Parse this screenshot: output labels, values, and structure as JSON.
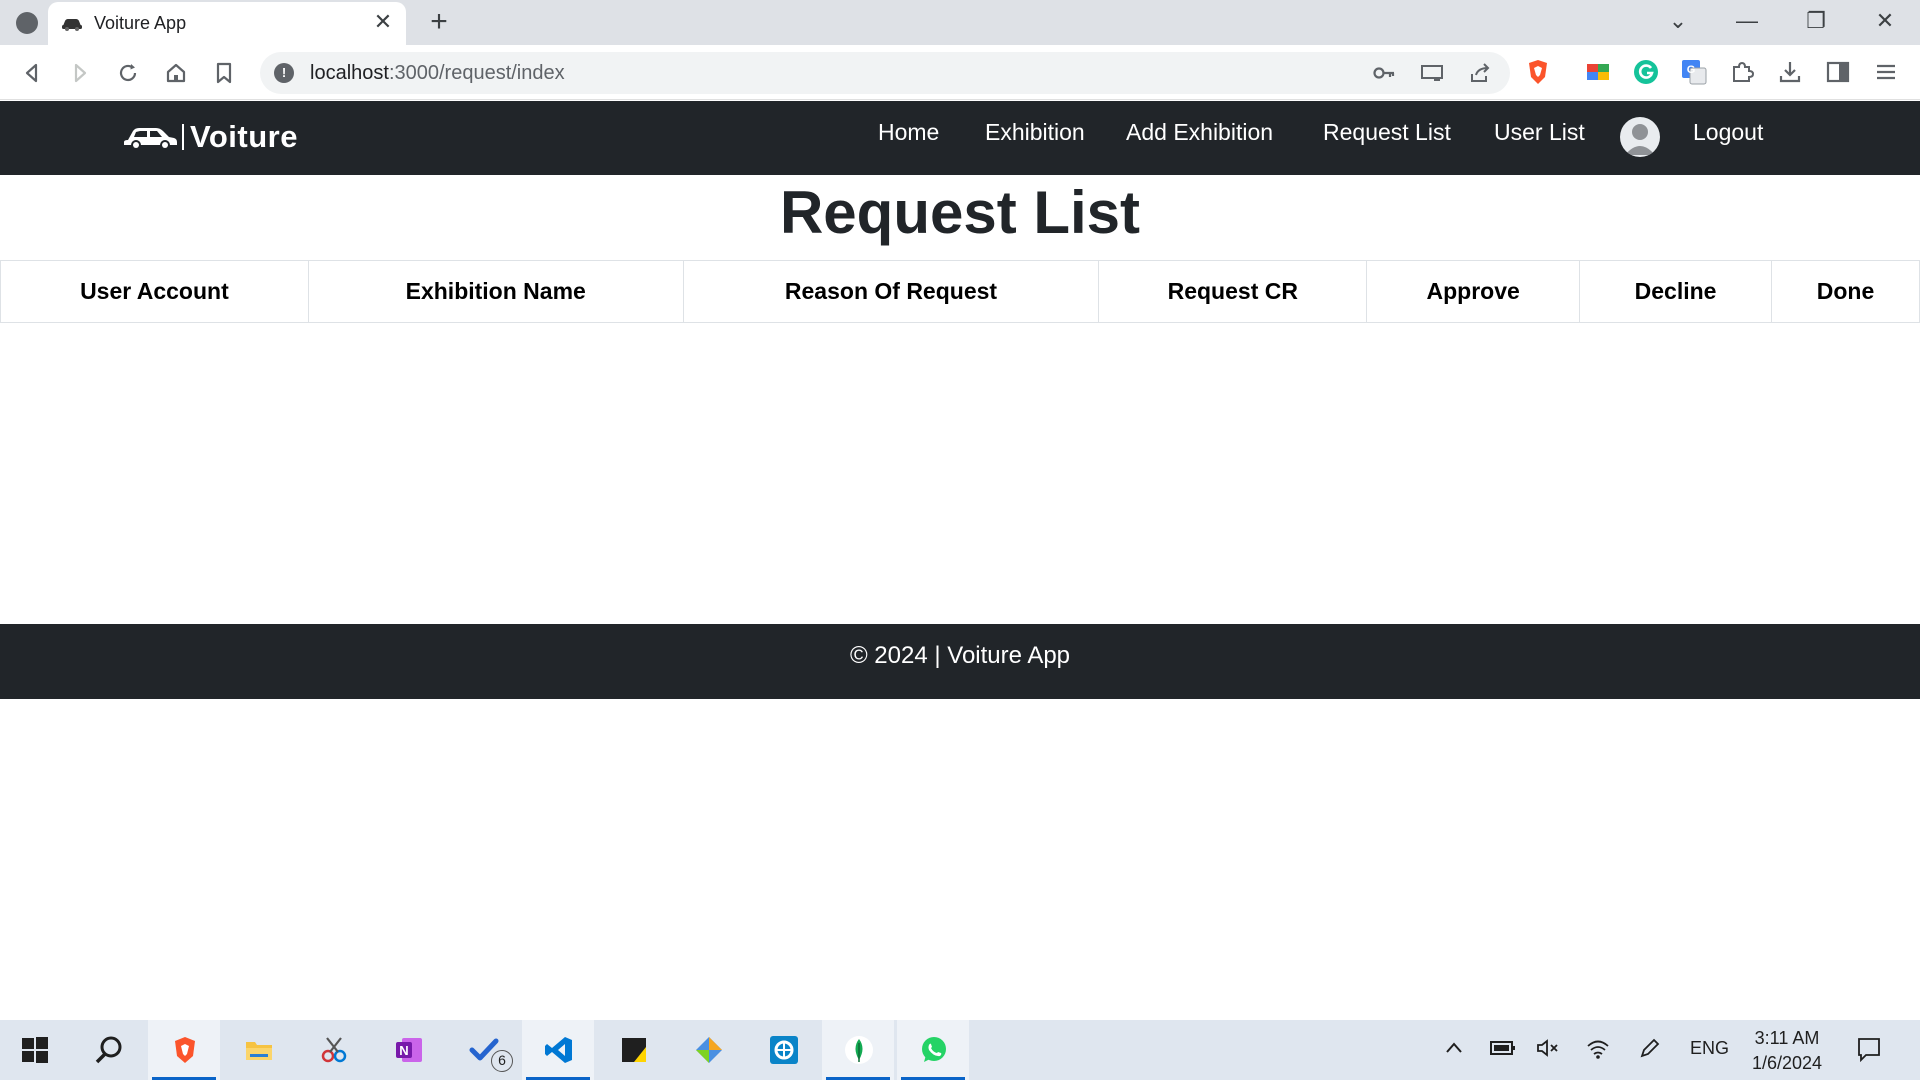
{
  "browser": {
    "tab_title": "Voiture App",
    "tab_close": "✕",
    "new_tab": "+",
    "url_host": "localhost",
    "url_path": ":3000/request/index",
    "window_controls": [
      "⌄",
      "—",
      "❐",
      "✕"
    ]
  },
  "navbar": {
    "brand": "Voiture",
    "items": [
      "Home",
      "Exhibition",
      "Add Exhibition",
      "Request List",
      "User List"
    ],
    "logout": "Logout"
  },
  "page": {
    "title": "Request List",
    "columns": [
      "User Account",
      "Exhibition Name",
      "Reason Of Request",
      "Request CR",
      "Approve",
      "Decline",
      "Done"
    ],
    "rows": []
  },
  "footer": {
    "text": "© 2024 | Voiture App"
  },
  "taskbar": {
    "badge_count": "6",
    "language": "ENG",
    "time": "3:11 AM",
    "date": "1/6/2024"
  },
  "colors": {
    "navbar_bg": "#212529",
    "footer_bg": "#212529",
    "taskbar_bg": "#dfe6ef"
  }
}
